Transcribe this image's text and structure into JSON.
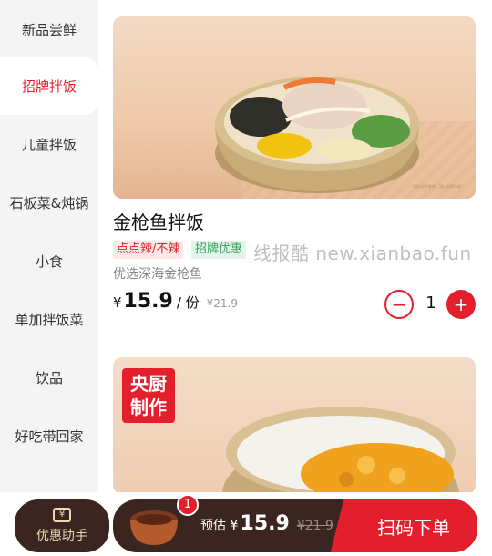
{
  "sidebar": {
    "items": [
      {
        "label": "新品尝鲜"
      },
      {
        "label": "招牌拌饭"
      },
      {
        "label": "儿童拌饭"
      },
      {
        "label": "石板菜&炖锅"
      },
      {
        "label": "小食"
      },
      {
        "label": "单加拌饭菜"
      },
      {
        "label": "饮品"
      },
      {
        "label": "好吃带回家"
      }
    ],
    "active_index": 1
  },
  "product1": {
    "title": "金枪鱼拌饭",
    "tags": [
      "点点辣/不辣",
      "招牌优惠"
    ],
    "description": "优选深海金枪鱼",
    "price": {
      "currency": "¥",
      "value": "15.9",
      "unit": "/ 份",
      "original": "¥21.9"
    },
    "quantity": "1",
    "image_note": "*图片仅供参考，请以实物为准*"
  },
  "watermark": "线报酷 new.xianbao.fun",
  "product2": {
    "badge_line1": "央厨",
    "badge_line2": "制作"
  },
  "bottom": {
    "helper_label": "优惠助手",
    "helper_icon_glyph": "¥",
    "cart_count": "1",
    "estimate_label": "预估",
    "currency": "¥",
    "estimate_value": "15.9",
    "estimate_original": "¥21.9",
    "checkout_label": "扫码下单"
  },
  "colors": {
    "accent": "#e41f2d",
    "dark": "#3b2520",
    "tag_green": "#3aa35c"
  }
}
